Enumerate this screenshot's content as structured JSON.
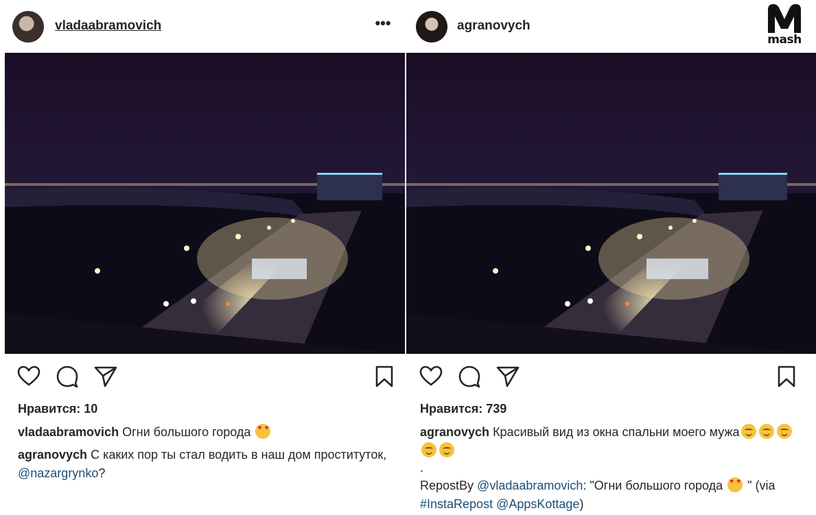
{
  "left_post": {
    "username": "vladaabramovich",
    "more_label": "•••",
    "likes_text": "Нравится: 10",
    "caption": {
      "user": "vladaabramovich",
      "text": "Огни большого города"
    },
    "comment": {
      "user": "agranovych",
      "text_before": "С каких пор ты стал водить в наш дом проституток, ",
      "mention": "@nazargrynko",
      "text_after": "?"
    }
  },
  "right_post": {
    "username": "agranovych",
    "likes_text": "Нравится: 739",
    "caption": {
      "user": "agranovych",
      "text": "Красивый вид из окна спальни моего мужа"
    },
    "dot": ".",
    "repost": {
      "prefix": "RepostBy ",
      "mention": "@vladaabramovich",
      "quote": ": \"Огни большого города",
      "end_quote": " \" (via ",
      "hashtag": "#InstaRepost",
      "mention2": "@AppsKottage",
      "close": ")"
    }
  },
  "watermark": {
    "text": "mash",
    "letter": "M"
  },
  "icons": {
    "like": "heart-icon",
    "comment": "comment-icon",
    "share": "send-icon",
    "save": "bookmark-icon",
    "more": "more-dots-icon"
  }
}
